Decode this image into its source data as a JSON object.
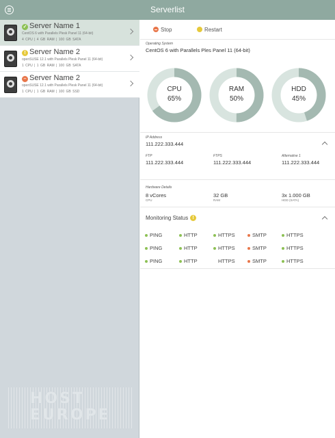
{
  "header": {
    "title": "Serverlist"
  },
  "colors": {
    "ok": "#8dc154",
    "warning": "#e6c93b",
    "stopped": "#e8764a",
    "header": "#8fa9a0",
    "gauge_fill": "#a4b9b1",
    "gauge_track": "#d8e4df"
  },
  "servers": [
    {
      "name": "Server Name 1",
      "status": "running",
      "status_glyph": "✓",
      "os": "CentOS 6 with Parallels Plesk Panel 11 (64-bit)",
      "specs": "4 CPU   |   4 GB RAM   |   100 GB SATA"
    },
    {
      "name": "Server Name 2",
      "status": "warning",
      "status_glyph": "!",
      "os": "openSUSE 12.1 with Parallels Plesk Panel 11 (64-bit)",
      "specs": "1 CPU   |   1 GB RAM   |   100 GB SATA"
    },
    {
      "name": "Server Name 2",
      "status": "stopped",
      "status_glyph": "–",
      "os": "openSUSE 12.1 with Parallels Plesk Panel 11 (64-bit)",
      "specs": "1 CPU   |   1 GB RAM   |   100 GB SSD"
    }
  ],
  "branding": {
    "line1": "HOST",
    "line2": "EUROPE"
  },
  "actions": {
    "stop": "Stop",
    "restart": "Restart"
  },
  "os_section": {
    "label": "Operating System",
    "value": "CentOS 6 with Parallels Ples Panel 11 (64-bit)"
  },
  "usage": [
    {
      "name": "CPU",
      "display": "65%",
      "percent": 65
    },
    {
      "name": "RAM",
      "display": "50%",
      "percent": 50
    },
    {
      "name": "HDD",
      "display": "45%",
      "percent": 45
    }
  ],
  "ip_section": {
    "label": "IP Address",
    "value": "111.222.333.444",
    "ftp_label": "FTP",
    "ftp_value": "111.222.333.444",
    "ftps_label": "FTPS",
    "ftps_value": "111.222.333.444",
    "alt_label": "Alternative 1",
    "alt_value": "111.222.333.444"
  },
  "hardware": {
    "label": "Hardware Details",
    "cpu_value": "8 vCores",
    "cpu_label": "CPU",
    "ram_value": "32 GB",
    "ram_label": "RAM",
    "hdd_value": "3x 1.000 GB",
    "hdd_label": "HDD (SATA)"
  },
  "monitoring": {
    "title": "Monitoring Status",
    "info_glyph": "!",
    "rows": [
      [
        {
          "label": "PING",
          "status": "ok"
        },
        {
          "label": "HTTP",
          "status": "ok"
        },
        {
          "label": "HTTPS",
          "status": "ok"
        },
        {
          "label": "SMTP",
          "status": "error"
        },
        {
          "label": "HTTPS",
          "status": "ok"
        }
      ],
      [
        {
          "label": "PING",
          "status": "ok"
        },
        {
          "label": "HTTP",
          "status": "ok"
        },
        {
          "label": "HTTPS",
          "status": "ok"
        },
        {
          "label": "SMTP",
          "status": "error"
        },
        {
          "label": "HTTPS",
          "status": "ok"
        }
      ],
      [
        {
          "label": "PING",
          "status": "ok"
        },
        {
          "label": "HTTP",
          "status": "ok"
        },
        {
          "label": "HTTPS",
          "status": "none"
        },
        {
          "label": "SMTP",
          "status": "error"
        },
        {
          "label": "HTTPS",
          "status": "ok"
        }
      ]
    ]
  }
}
